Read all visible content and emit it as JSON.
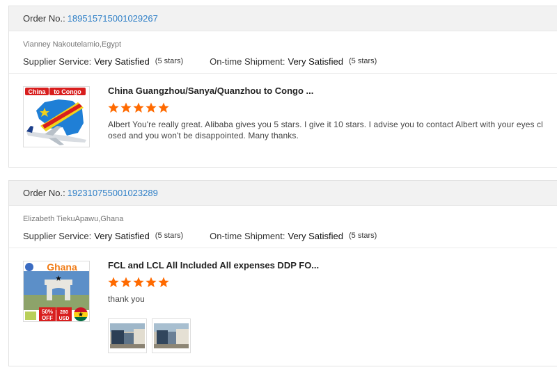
{
  "reviews": [
    {
      "order_label": "Order No.:",
      "order_number": "189515715001029267",
      "buyer": "Vianney Nakoutelamio,Egypt",
      "supplier_service_label": "Supplier Service:",
      "supplier_service_value": "Very Satisfied",
      "supplier_service_stars": "(5 stars)",
      "shipment_label": "On-time Shipment:",
      "shipment_value": "Very Satisfied",
      "shipment_stars": "(5 stars)",
      "product_title": "China Guangzhou/Sanya/Quanzhou to Congo ...",
      "rating": 5,
      "comment": "Albert You're really great. Alibaba gives you 5 stars. I give it 10 stars. I advise you to contact Albert with your eyes closed and you won't be disappointed. Many thanks.",
      "thumb_text_a": "China",
      "thumb_text_b": "to Congo"
    },
    {
      "order_label": "Order No.:",
      "order_number": "192310755001023289",
      "buyer": "Elizabeth TiekuApawu,Ghana",
      "supplier_service_label": "Supplier Service:",
      "supplier_service_value": "Very Satisfied",
      "supplier_service_stars": "(5 stars)",
      "shipment_label": "On-time Shipment:",
      "shipment_value": "Very Satisfied",
      "shipment_stars": "(5 stars)",
      "product_title": "FCL and LCL All Included All expenses DDP FO...",
      "rating": 5,
      "comment": "thank you",
      "thumb_text_a": "Ghana",
      "thumb_badge_a": "50%",
      "thumb_badge_b": "OFF",
      "thumb_badge_c": "280",
      "thumb_badge_d": "USD"
    }
  ],
  "colors": {
    "star": "#ff6a00",
    "link": "#2e7fc7",
    "header_bg": "#f2f2f2"
  }
}
